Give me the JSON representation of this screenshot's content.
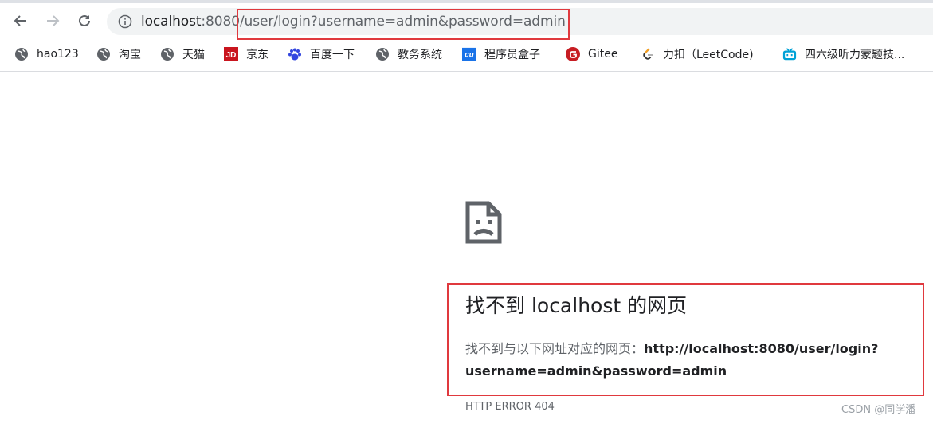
{
  "address_bar": {
    "host": "localhost",
    "port_path": ":8080/user/login?username=admin&password=admin"
  },
  "bookmarks": [
    {
      "label": "hao123",
      "icon": "globe-icon"
    },
    {
      "label": "淘宝",
      "icon": "globe-icon"
    },
    {
      "label": "天猫",
      "icon": "globe-icon"
    },
    {
      "label": "京东",
      "icon": "jd-logo-icon",
      "badge": "JD"
    },
    {
      "label": "百度一下",
      "icon": "baidu-paw-icon"
    },
    {
      "label": "教务系统",
      "icon": "globe-icon"
    },
    {
      "label": "程序员盒子",
      "icon": "cu-logo-icon",
      "badge": "cu"
    },
    {
      "label": "Gitee",
      "icon": "gitee-logo-icon"
    },
    {
      "label": "力扣（LeetCode)",
      "icon": "leetcode-logo-icon"
    },
    {
      "label": "四六级听力蒙题技...",
      "icon": "bilibili-icon"
    }
  ],
  "error": {
    "title": "找不到 localhost 的网页",
    "desc_prefix": "找不到与以下网址对应的网页：",
    "desc_url_line1": "http://localhost:8080/user/login?",
    "desc_url_line2": "username=admin&password=admin",
    "code": "HTTP ERROR 404"
  },
  "watermark": "CSDN @同学潘",
  "colors": {
    "highlight": "#e0393e",
    "jd": "#c9151e",
    "cu": "#1a73e8",
    "gitee": "#c71d23",
    "bilibili": "#00a1d6"
  }
}
